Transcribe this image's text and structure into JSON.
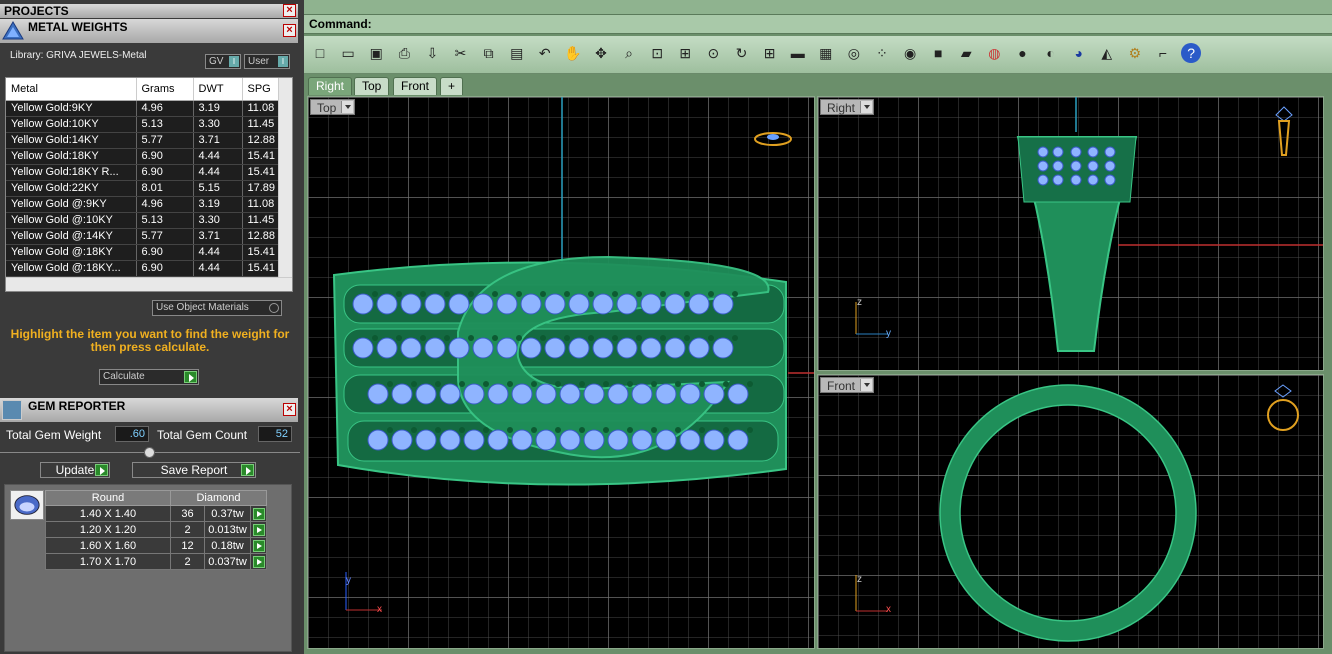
{
  "projects_panel": {
    "title": "PROJECTS"
  },
  "metal_weights": {
    "title": "METAL WEIGHTS",
    "library_label": "Library: GRIVA JEWELS-Metal",
    "gv_label": "GV",
    "user_label": "User",
    "columns": [
      "Metal",
      "Grams",
      "DWT",
      "SPG"
    ],
    "rows": [
      [
        "Yellow Gold:9KY",
        "4.96",
        "3.19",
        "11.08"
      ],
      [
        "Yellow Gold:10KY",
        "5.13",
        "3.30",
        "11.45"
      ],
      [
        "Yellow Gold:14KY",
        "5.77",
        "3.71",
        "12.88"
      ],
      [
        "Yellow Gold:18KY",
        "6.90",
        "4.44",
        "15.41"
      ],
      [
        "Yellow Gold:18KY R...",
        "6.90",
        "4.44",
        "15.41"
      ],
      [
        "Yellow Gold:22KY",
        "8.01",
        "5.15",
        "17.89"
      ],
      [
        "Yellow Gold @:9KY",
        "4.96",
        "3.19",
        "11.08"
      ],
      [
        "Yellow Gold @:10KY",
        "5.13",
        "3.30",
        "11.45"
      ],
      [
        "Yellow Gold @:14KY",
        "5.77",
        "3.71",
        "12.88"
      ],
      [
        "Yellow Gold @:18KY",
        "6.90",
        "4.44",
        "15.41"
      ],
      [
        "Yellow Gold @:18KY...",
        "6.90",
        "4.44",
        "15.41"
      ]
    ],
    "use_object_materials": "Use Object Materials",
    "instruction": "Highlight the item you want to find the weight for then press calculate.",
    "calculate_label": "Calculate"
  },
  "gem_reporter": {
    "title": "GEM REPORTER",
    "total_weight_label": "Total Gem Weight",
    "total_weight_value": ".60",
    "total_count_label": "Total Gem Count",
    "total_count_value": "52",
    "update_label": "Update",
    "save_report_label": "Save Report",
    "columns": [
      "Round",
      "Diamond"
    ],
    "rows": [
      [
        "1.40 X 1.40",
        "36",
        "0.37tw"
      ],
      [
        "1.20 X 1.20",
        "2",
        "0.013tw"
      ],
      [
        "1.60 X 1.60",
        "12",
        "0.18tw"
      ],
      [
        "1.70 X 1.70",
        "2",
        "0.037tw"
      ]
    ]
  },
  "command": {
    "label": "Command:"
  },
  "toolbar_icons": [
    "new-file-icon",
    "open-folder-icon",
    "save-icon",
    "print-icon",
    "export-icon",
    "cut-icon",
    "copy-icon",
    "paste-icon",
    "undo-icon",
    "pan-hand-icon",
    "rotate-view-icon",
    "zoom-icon",
    "zoom-window-icon",
    "zoom-extents-icon",
    "zoom-selected-icon",
    "zoom-dynamic-icon",
    "four-viewports-icon",
    "car-icon",
    "grid-snap-icon",
    "osnap-icon",
    "points-icon",
    "light-icon",
    "lock-icon",
    "layers-icon",
    "color-wheel-icon",
    "shade-icon",
    "render-icon",
    "material-sphere-icon",
    "light-cone-icon",
    "settings-gear-icon",
    "dimension-icon",
    "help-icon"
  ],
  "view_tabs": [
    "Right",
    "Top",
    "Front",
    "+"
  ],
  "viewports": {
    "top": {
      "label": "Top"
    },
    "right": {
      "label": "Right"
    },
    "front": {
      "label": "Front"
    }
  },
  "axes": {
    "x": "x",
    "y": "y",
    "z": "z"
  },
  "colors": {
    "ring_green": "#1f8f5a",
    "gem_blue": "#8fb4ff",
    "accent_green": "#2a8a2a",
    "highlight_orange": "#f0b020"
  }
}
